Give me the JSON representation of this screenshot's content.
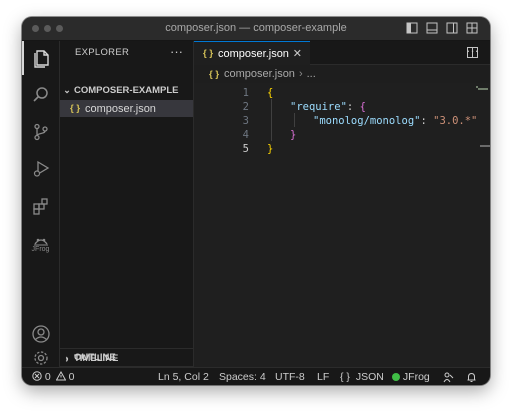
{
  "window": {
    "title": "composer.json — composer-example"
  },
  "explorer": {
    "header": "EXPLORER",
    "more": "···",
    "folder": "COMPOSER-EXAMPLE",
    "file": "composer.json",
    "file_icon": "{ }",
    "outline": "OUTLINE",
    "timeline": "TIMELINE"
  },
  "activity": {
    "items": [
      "files-icon",
      "search-icon",
      "source-control-icon",
      "run-debug-icon",
      "extensions-icon",
      "jfrog-icon"
    ],
    "jfrog_label": "JFrog",
    "bottom": [
      "account-icon",
      "settings-icon"
    ]
  },
  "editor": {
    "tab_label": "composer.json",
    "tab_icon": "{ }",
    "breadcrumb_file": "composer.json",
    "breadcrumb_more": "...",
    "lines": [
      {
        "n": "1",
        "text": "{"
      },
      {
        "n": "2",
        "text": "\"require\": {"
      },
      {
        "n": "3",
        "text": "\"monolog/monolog\": \"3.0.*\""
      },
      {
        "n": "4",
        "text": "}"
      },
      {
        "n": "5",
        "text": "}"
      }
    ],
    "tokens": {
      "l2_key": "\"require\"",
      "l2_colon": ": ",
      "l2_brace": "{",
      "l3_key": "\"monolog/monolog\"",
      "l3_colon": ": ",
      "l3_value": "\"3.0.*\""
    },
    "current_line": "5"
  },
  "status": {
    "errors": "0",
    "warnings": "0",
    "position": "Ln 5, Col 2",
    "spaces": "Spaces: 4",
    "encoding": "UTF-8",
    "eol": "LF",
    "language_icon": "{ }",
    "language": "JSON",
    "jfrog": "JFrog"
  },
  "colors": {
    "accent": "#0078d4",
    "json_key": "#9cdcfe",
    "json_string": "#ce9178",
    "brace_level1": "#ffd700",
    "brace_level2": "#da70d6",
    "jfrog_green": "#40be46"
  }
}
